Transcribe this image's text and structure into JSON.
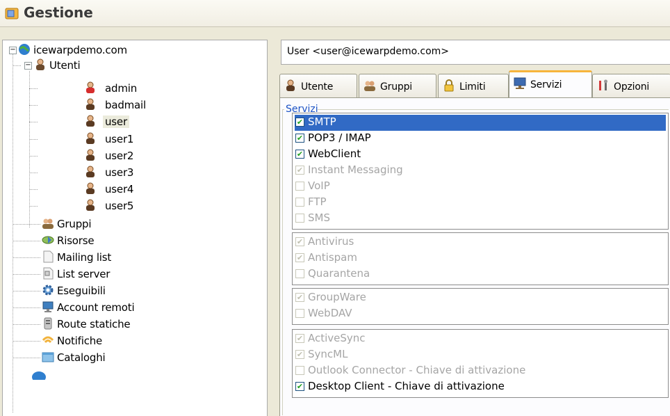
{
  "window": {
    "title": "Gestione"
  },
  "tree": {
    "root": "icewarpdemo.com",
    "utenti": "Utenti",
    "users": [
      "admin",
      "badmail",
      "user",
      "user1",
      "user2",
      "user3",
      "user4",
      "user5"
    ],
    "selected_user": "user",
    "folders": [
      "Gruppi",
      "Risorse",
      "Mailing list",
      "List server",
      "Eseguibili",
      "Account remoti",
      "Route statiche",
      "Notifiche",
      "Cataloghi"
    ]
  },
  "account_bar": {
    "text": "User <user@icewarpdemo.com>"
  },
  "tabs": [
    {
      "label": "Utente",
      "icon": "user-icon",
      "active": false
    },
    {
      "label": "Gruppi",
      "icon": "group-icon",
      "active": false
    },
    {
      "label": "Limiti",
      "icon": "lock-icon",
      "active": false
    },
    {
      "label": "Servizi",
      "icon": "monitor-icon",
      "active": true
    },
    {
      "label": "Opzioni",
      "icon": "tools-icon",
      "active": false
    }
  ],
  "services_group": {
    "title": "Servizi",
    "boxes": [
      [
        {
          "label": "SMTP",
          "checked": true,
          "enabled": true,
          "highlighted": true
        },
        {
          "label": "POP3 / IMAP",
          "checked": true,
          "enabled": true
        },
        {
          "label": "WebClient",
          "checked": true,
          "enabled": true
        },
        {
          "label": "Instant Messaging",
          "checked": true,
          "enabled": false
        },
        {
          "label": "VoIP",
          "checked": false,
          "enabled": false
        },
        {
          "label": "FTP",
          "checked": false,
          "enabled": false
        },
        {
          "label": "SMS",
          "checked": false,
          "enabled": false
        }
      ],
      [
        {
          "label": "Antivirus",
          "checked": true,
          "enabled": false
        },
        {
          "label": "Antispam",
          "checked": true,
          "enabled": false
        },
        {
          "label": "Quarantena",
          "checked": false,
          "enabled": false
        }
      ],
      [
        {
          "label": "GroupWare",
          "checked": true,
          "enabled": false
        },
        {
          "label": "WebDAV",
          "checked": false,
          "enabled": false
        }
      ],
      [
        {
          "label": "ActiveSync",
          "checked": true,
          "enabled": false
        },
        {
          "label": "SyncML",
          "checked": true,
          "enabled": false
        },
        {
          "label": "Outlook Connector - Chiave di attivazione",
          "checked": false,
          "enabled": false
        },
        {
          "label": "Desktop Client - Chiave di attivazione",
          "checked": true,
          "enabled": true
        }
      ]
    ]
  },
  "colors": {
    "selection": "#316ac5",
    "group_title": "#1b52c5",
    "active_tab_accent": "#f7b43c",
    "check": "#21a121"
  }
}
